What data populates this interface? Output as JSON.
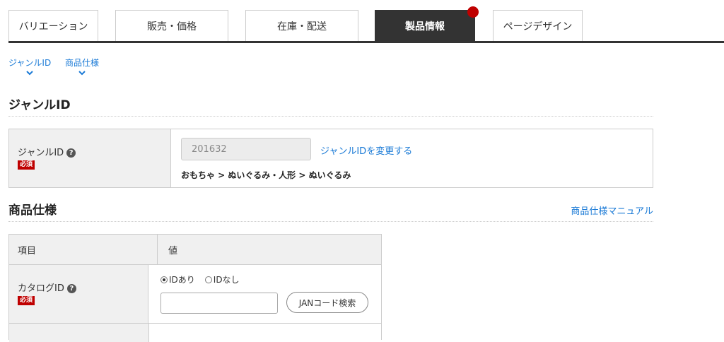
{
  "tabs": [
    {
      "label": "バリエーション"
    },
    {
      "label": "販売・価格"
    },
    {
      "label": "在庫・配送"
    },
    {
      "label": "製品情報"
    },
    {
      "label": "ページデザイン"
    }
  ],
  "colors": {
    "accent": "#bf0000",
    "link": "#1a7ad6",
    "tab_active": "#333333"
  },
  "anchors": [
    {
      "label": "ジャンルID"
    },
    {
      "label": "商品仕様"
    }
  ],
  "genre": {
    "heading": "ジャンルID",
    "field_label": "ジャンルID",
    "required_badge": "必須",
    "value": "201632",
    "change_link": "ジャンルIDを変更する",
    "path": "おもちゃ > ぬいぐるみ・人形 > ぬいぐるみ"
  },
  "spec": {
    "heading": "商品仕様",
    "manual_link": "商品仕様マニュアル",
    "col_item": "項目",
    "col_value": "値",
    "catalog_label": "カタログID",
    "required_badge": "必須",
    "radio_with": "IDあり",
    "radio_without": "IDなし",
    "jan_input_value": "",
    "jan_button": "JANコード検索"
  }
}
